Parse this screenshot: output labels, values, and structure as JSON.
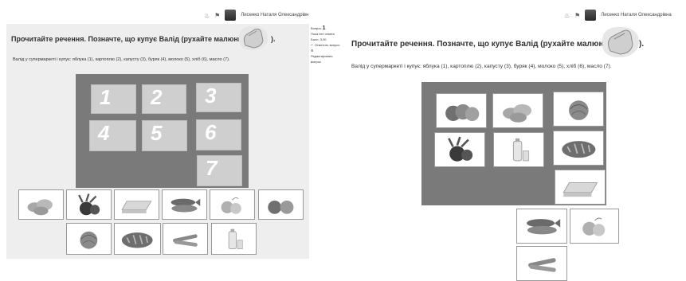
{
  "left": {
    "user_name": "Лисенко Наталя Олександрівн",
    "title_before": "Прочитайте речення. Позначте, що купує Валід (рухайте малюнки",
    "title_after": ").",
    "sentence": "Валід у супермаркеті і купує: яблука (1), картоплю (2), капусту (3),  буряк (4), молоко (5), хліб (6), масло (7).",
    "slots": [
      "1",
      "2",
      "3",
      "4",
      "5",
      "6",
      "7"
    ],
    "sidebar": {
      "question_label": "Вопрос",
      "question_number": "1",
      "status": "Пока нет ответа",
      "score": "Балл: 3,00",
      "flag_label": "Отметить вопрос",
      "edit_label": "Редактировать вопрос"
    },
    "cards_row1": [
      "potatoes",
      "beetroot",
      "butter",
      "fish",
      "peaches",
      "apples"
    ],
    "cards_row2": [
      "cabbage",
      "bread",
      "cucumbers",
      "milk"
    ]
  },
  "right": {
    "user_name": "Лисенко Наталя Олександрівна",
    "title_before": "Прочитайте речення. Позначте, що купує Валід (рухайте малюнки",
    "title_after": ").",
    "sentence": "Валід у супермаркеті і купує: яблука (1), картоплю (2), капусту (3),  буряк (4), молоко (5), хліб (6), масло (7).",
    "placed": [
      "apples",
      "potatoes",
      "cabbage",
      "beetroot",
      "milk",
      "bread",
      "butter"
    ],
    "remaining_row1": [
      "fish",
      "peaches"
    ],
    "remaining_row2": [
      "cucumbers"
    ]
  }
}
